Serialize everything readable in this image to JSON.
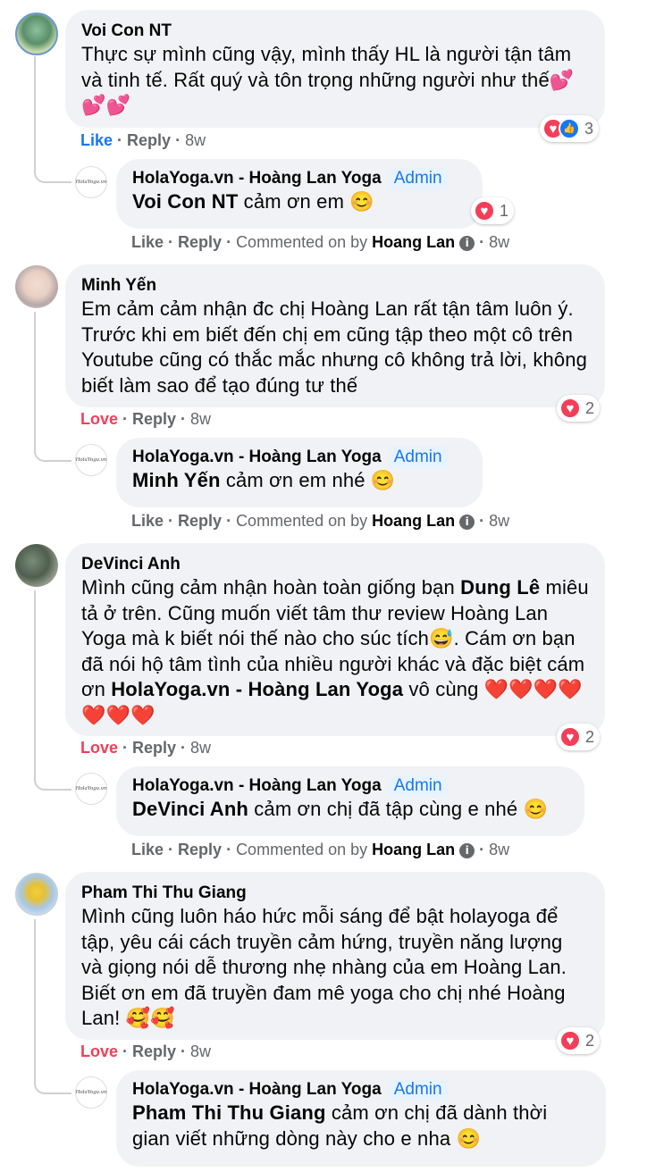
{
  "threads": [
    {
      "comment": {
        "author": "Voi Con NT",
        "text": "Thực sự mình cũng vậy, mình thấy HL là người tận tâm và tinh tế. Rất quý và tôn trọng những người như thế💕💕💕",
        "action": "Like",
        "reply": "Reply",
        "time": "8w",
        "reaction_count": "3"
      },
      "reply": {
        "author": "HolaYoga.vn - Hoàng Lan Yoga",
        "badge": "Admin",
        "mention": "Voi Con NT",
        "text": " cảm ơn em 😊",
        "action": "Like",
        "reply": "Reply",
        "commented_on_by": "Commented on by",
        "by_name": "Hoang Lan",
        "time": "8w",
        "reaction_count": "1",
        "avatar_text": "HolaYoga.vn"
      }
    },
    {
      "comment": {
        "author": "Minh Yến",
        "text": "Em cảm cảm nhận đc chị Hoàng Lan rất tận tâm luôn ý. Trước khi em biết đến chị em cũng tập theo một cô trên Youtube cũng có thắc mắc nhưng cô không trả lời, không biết làm sao để tạo đúng tư thế",
        "action": "Love",
        "reply": "Reply",
        "time": "8w",
        "reaction_count": "2"
      },
      "reply": {
        "author": "HolaYoga.vn - Hoàng Lan Yoga",
        "badge": "Admin",
        "mention": "Minh Yến",
        "text": " cảm ơn em nhé 😊",
        "action": "Like",
        "reply": "Reply",
        "commented_on_by": "Commented on by",
        "by_name": "Hoang Lan",
        "time": "8w",
        "avatar_text": "HolaYoga.vn"
      }
    },
    {
      "comment": {
        "author": "DeVinci Anh",
        "text_1": "Mình cũng cảm nhận hoàn toàn giống bạn ",
        "mention_1": "Dung Lê",
        "text_2": " miêu tả ở trên. Cũng muốn viết tâm thư review Hoàng Lan Yoga mà k biết nói thế nào cho súc tích😅. Cám ơn bạn đã nói hộ tâm tình của nhiều người khác và đặc biệt cám ơn ",
        "mention_2": "HolaYoga.vn - Hoàng Lan Yoga",
        "text_3": " vô cùng ❤️❤️❤️❤️❤️❤️❤️",
        "action": "Love",
        "reply": "Reply",
        "time": "8w",
        "reaction_count": "2"
      },
      "reply": {
        "author": "HolaYoga.vn - Hoàng Lan Yoga",
        "badge": "Admin",
        "mention": "DeVinci Anh",
        "text": " cảm ơn chị đã tập cùng e nhé 😊",
        "action": "Like",
        "reply": "Reply",
        "commented_on_by": "Commented on by",
        "by_name": "Hoang Lan",
        "time": "8w",
        "avatar_text": "HolaYoga.vn"
      }
    },
    {
      "comment": {
        "author": "Pham Thi Thu Giang",
        "text": "Mình cũng luôn háo hức mỗi sáng để bật holayoga để tập, yêu cái cách truyền cảm hứng, truyền năng lượng và giọng nói dễ thương nhẹ nhàng của em Hoàng Lan. Biết ơn em đã truyền đam mê yoga cho chị nhé Hoàng Lan! 🥰🥰",
        "action": "Love",
        "reply": "Reply",
        "time": "8w",
        "reaction_count": "2"
      },
      "reply": {
        "author": "HolaYoga.vn - Hoàng Lan Yoga",
        "badge": "Admin",
        "mention": "Pham Thi Thu Giang",
        "text": " cảm ơn chị đã dành thời gian viết những dòng này cho e nha 😊",
        "avatar_text": "HolaYoga.vn"
      }
    }
  ],
  "icons": {
    "love_reaction": "heart-icon",
    "like_reaction": "thumbs-up-icon",
    "info": "info-icon"
  },
  "colors": {
    "bubble": "#f0f2f5",
    "link_blue": "#1877f2",
    "love_red": "#f33e58",
    "muted": "#65676b"
  }
}
